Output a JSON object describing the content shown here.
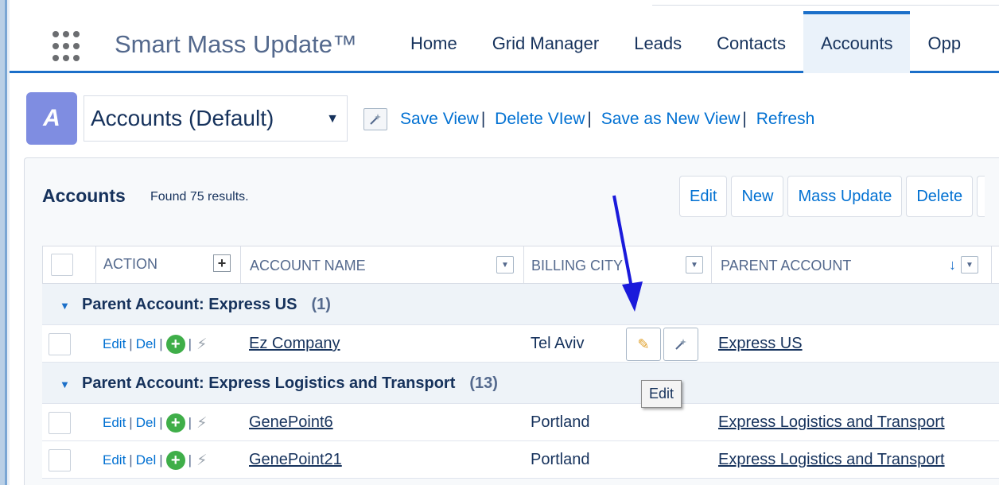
{
  "header": {
    "app_name": "Smart Mass Update™",
    "nav": [
      "Home",
      "Grid Manager",
      "Leads",
      "Contacts",
      "Accounts",
      "Opp"
    ],
    "active_tab": "Accounts",
    "accent_color": "#1b6fc9"
  },
  "view": {
    "object_icon_letter": "A",
    "selected_view": "Accounts (Default)",
    "links": [
      "Save View",
      "Delete VIew",
      "Save as New View",
      "Refresh"
    ],
    "link_separator": "|"
  },
  "list": {
    "title": "Accounts",
    "count_text": "Found 75 results.",
    "buttons": [
      "Edit",
      "New",
      "Mass Update",
      "Delete"
    ]
  },
  "table": {
    "columns": [
      "ACTION",
      "ACCOUNT NAME",
      "BILLING CITY",
      "PARENT ACCOUNT"
    ],
    "action_links": {
      "edit": "Edit",
      "del": "Del",
      "sep": "|"
    },
    "groups": [
      {
        "label": "Parent Account: Express US",
        "count": "(1)",
        "rows": [
          {
            "account_name": "Ez Company",
            "billing_city": "Tel Aviv",
            "parent_account": "Express US"
          }
        ]
      },
      {
        "label": "Parent Account: Express Logistics and Transport",
        "count": "(13)",
        "rows": [
          {
            "account_name": "GenePoint6",
            "billing_city": "Portland",
            "parent_account": "Express Logistics and Transport"
          },
          {
            "account_name": "GenePoint21",
            "billing_city": "Portland",
            "parent_account": "Express Logistics and Transport"
          }
        ]
      }
    ]
  },
  "tooltip": "Edit",
  "icons": {
    "app_launcher": "waffle-icon",
    "view_action": "magic-wand-icon",
    "add": "plus-circle-icon",
    "quick_action": "lightning-bolt-icon",
    "inline_edit": "pencil-icon",
    "inline_mass": "magic-wand-icon",
    "sort": "arrow-down-icon",
    "column_menu": "chevron-down-icon"
  }
}
